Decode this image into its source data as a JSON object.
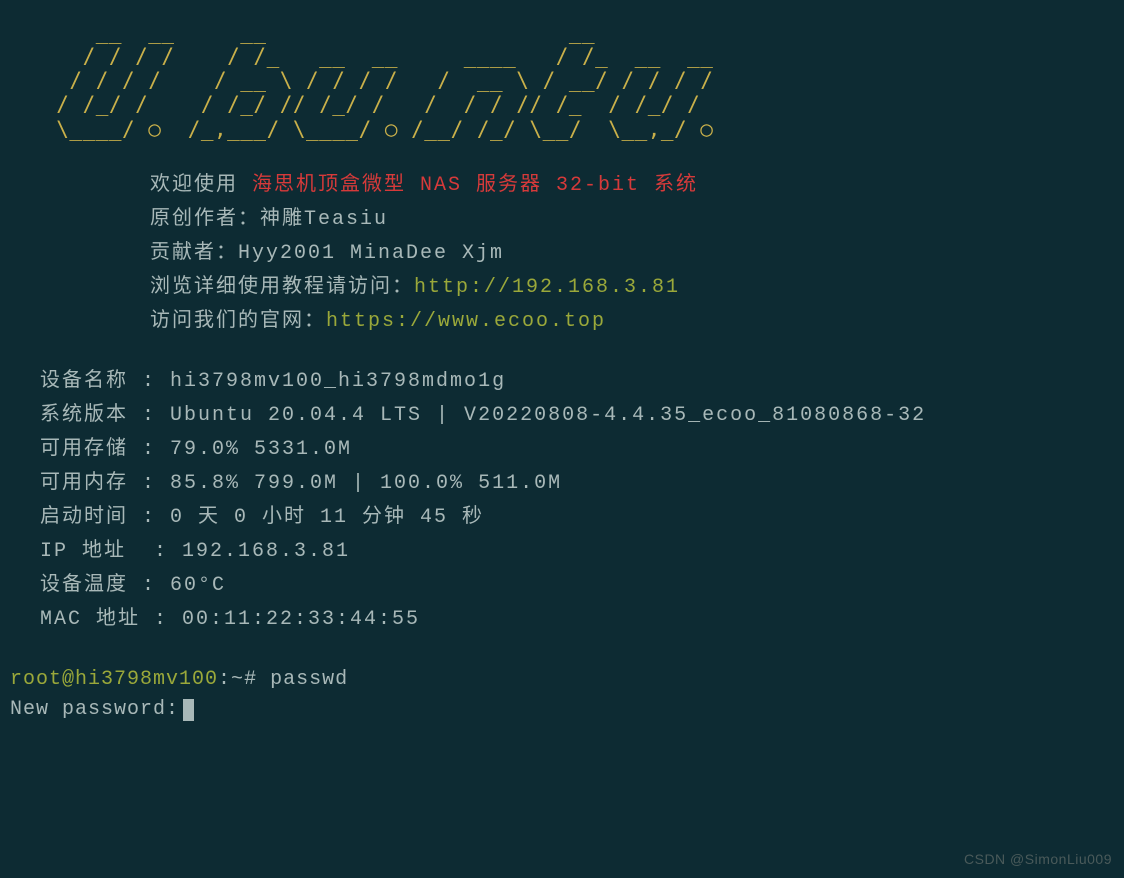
{
  "ascii_art": "     __  __     __                       __\n    / / / /    / /_   __  __     ____   / /_  __  __\n   / / / /    / __ \\ / / / /   /  __ \\ / __/ / / / /\n  / /_/ /    / /_/ // /_/ /   /  / / // /_  / /_/ /\n  \\____/ ○  /_,___/ \\____/ ○ /__/ /_/ \\__/  \\__,_/ ○",
  "welcome": {
    "line1_prefix": "欢迎使用",
    "line1_highlight": " 海思机顶盒微型 NAS 服务器 32-bit 系统",
    "line2": "原创作者：神雕Teasiu",
    "line3": "贡献者：Hyy2001 MinaDee Xjm",
    "line4_prefix": "浏览详细使用教程请访问：",
    "line4_url": "http://192.168.3.81",
    "line5_prefix": "访问我们的官网：",
    "line5_url": "https://www.ecoo.top"
  },
  "info": {
    "device_name": {
      "label": "设备名称 ",
      "value": ": hi3798mv100_hi3798mdmo1g"
    },
    "system_version": {
      "label": "系统版本 ",
      "value": ": Ubuntu 20.04.4 LTS | V20220808-4.4.35_ecoo_81080868-32"
    },
    "storage": {
      "label": "可用存储 ",
      "value": ": 79.0% 5331.0M"
    },
    "memory": {
      "label": "可用内存 ",
      "value": ": 85.8% 799.0M | 100.0% 511.0M"
    },
    "uptime": {
      "label": "启动时间 ",
      "value": ": 0 天 0 小时 11 分钟 45 秒"
    },
    "ip": {
      "label": "IP 地址  ",
      "value": ": 192.168.3.81"
    },
    "temp": {
      "label": "设备温度 ",
      "value": ": 60°C"
    },
    "mac": {
      "label": "MAC 地址 ",
      "value": ": 00:11:22:33:44:55"
    }
  },
  "prompt": {
    "user_host": "root@hi3798mv100",
    "path_sep": ":",
    "path": "~",
    "symbol": "#",
    "command": "passwd",
    "new_password_label": "New password:"
  },
  "watermark": "CSDN @SimonLiu009"
}
